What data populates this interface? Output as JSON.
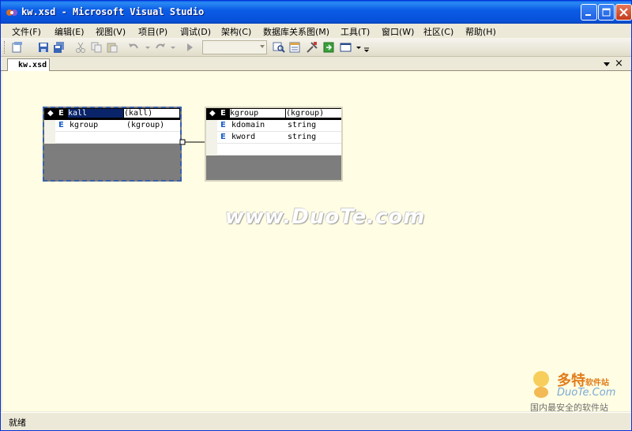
{
  "window": {
    "title": "kw.xsd - Microsoft Visual Studio"
  },
  "menu": [
    {
      "label": "文件(F)"
    },
    {
      "label": "编辑(E)"
    },
    {
      "label": "视图(V)"
    },
    {
      "label": "项目(P)"
    },
    {
      "label": "调试(D)"
    },
    {
      "label": "架构(C)"
    },
    {
      "label": "数据库关系图(M)"
    },
    {
      "label": "工具(T)"
    },
    {
      "label": "窗口(W)"
    },
    {
      "label": "社区(C)"
    },
    {
      "label": "帮助(H)"
    }
  ],
  "toolbar": {
    "combo_value": ""
  },
  "doc_tab": {
    "label": "kw.xsd",
    "close_glyph": "×"
  },
  "elements": [
    {
      "header_badge": "E",
      "name": "kall",
      "type": "(kall)",
      "rows": [
        {
          "badge": "E",
          "name": "kgroup",
          "type": "(kgroup)"
        }
      ]
    },
    {
      "header_badge": "E",
      "name": "kgroup",
      "type": "(kgroup)",
      "rows": [
        {
          "badge": "E",
          "name": "kdomain",
          "type": "string"
        },
        {
          "badge": "E",
          "name": "kword",
          "type": "string"
        }
      ]
    }
  ],
  "watermark": "www.DuoTe.com",
  "logo": {
    "brand": "多特",
    "tagline": "软件站",
    "domain": "DuoTe.Com",
    "slogan": "国内最安全的软件站"
  },
  "status": {
    "text": "就绪"
  },
  "colors": {
    "titlebar": "#0a5ee8",
    "surface": "#fffde3",
    "element_body": "#7d7d7d",
    "badge_blue": "#1a5fc7"
  }
}
